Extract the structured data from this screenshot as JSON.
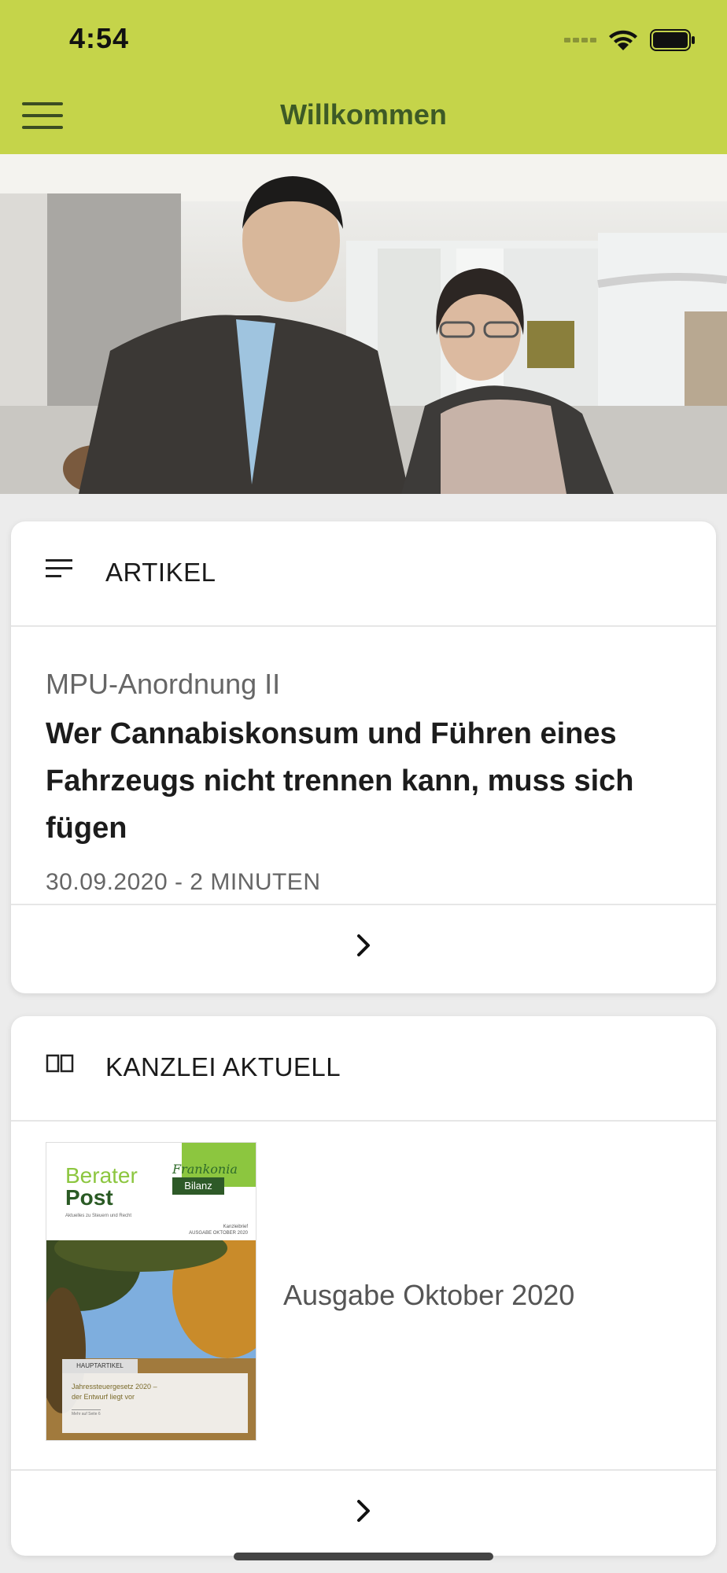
{
  "status_bar": {
    "time": "4:54"
  },
  "nav": {
    "title": "Willkommen"
  },
  "hero": {
    "description": ""
  },
  "articles_card": {
    "header": "ARTIKEL",
    "kicker": "MPU-Anordnung II",
    "headline": "Wer Cannabiskonsum und Führen eines Fahrzeugs nicht trennen kann, muss sich fügen",
    "meta": "30.09.2020 - 2 MINUTEN"
  },
  "kanzlei_card": {
    "header": "KANZLEI AKTUELL",
    "issue_label": "Ausgabe Oktober 2020",
    "cover": {
      "title_line1": "Berater",
      "title_line2": "Post",
      "tagline": "Aktuelles zu Steuern und Recht",
      "brand": "Frankonia",
      "brand_sub": "Bilanz",
      "issue_small1": "Kanzleibrief",
      "issue_small2": "AUSGABE OKTOBER 2020",
      "tag": "HAUPTARTIKEL",
      "teaser_line1": "Jahressteuergesetz 2020 –",
      "teaser_line2": "der Entwurf liegt vor",
      "teaser_more": "Mehr auf Seite 6"
    }
  },
  "colors": {
    "accent": "#c5d44a",
    "title_green": "#3d5a26",
    "background": "#ececec"
  },
  "icons": [
    "menu-icon",
    "list-icon",
    "book-icon",
    "chevron-right-icon",
    "wifi-icon",
    "battery-icon"
  ]
}
